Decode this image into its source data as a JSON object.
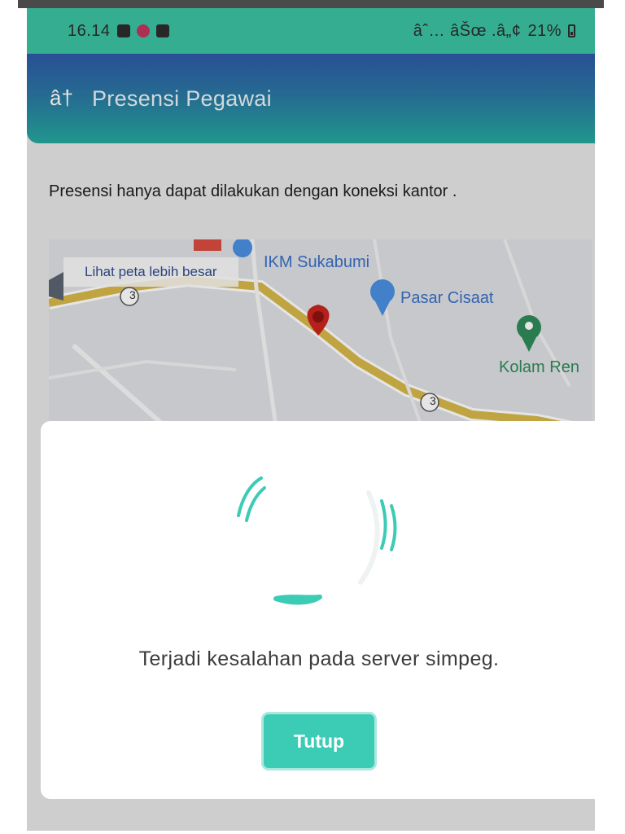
{
  "status_bar": {
    "time": "16.14",
    "indicators": "âˆ… âŠœ .â„¢",
    "battery": "21%"
  },
  "app_bar": {
    "back_icon": "â†",
    "title": "Presensi Pegawai"
  },
  "notice": "Presensi hanya dapat dilakukan dengan koneksi kantor .",
  "map": {
    "link_label": "Lihat peta lebih besar",
    "places": [
      "IKM Sukabumi",
      "Pasar Cisaat",
      "Kolam Ren"
    ],
    "road_number_1": "3",
    "road_number_2": "3",
    "colors": {
      "road": "#d6b74a",
      "pin": "#c9241d",
      "market_pin": "#4a8fe0",
      "park_pin": "#2f8b5a"
    }
  },
  "dialog": {
    "message": "Terjadi kesalahan pada server simpeg.",
    "close_label": "Tutup",
    "accent_color": "#3ccbb5"
  }
}
